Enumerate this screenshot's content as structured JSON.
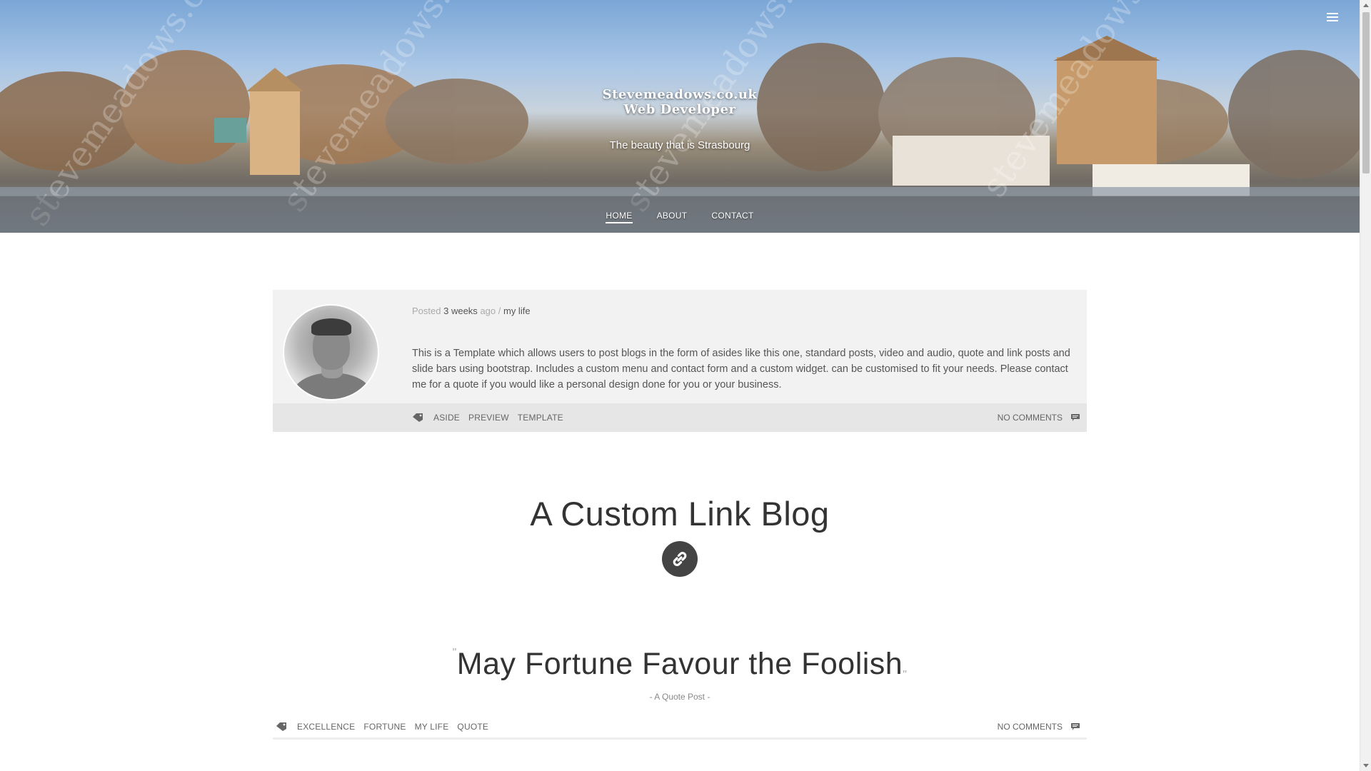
{
  "hero": {
    "title_line1": "Stevemeadows.co.uk",
    "title_line2": "Web Developer",
    "tagline": "The beauty that is Strasbourg",
    "watermark": "stevemeadows.co.uk"
  },
  "nav": {
    "items": [
      {
        "label": "HOME"
      },
      {
        "label": "ABOUT"
      },
      {
        "label": "CONTACT"
      }
    ]
  },
  "aside_post": {
    "meta_prefix": "Posted",
    "meta_time": "3 weeks",
    "meta_suffix": "ago /",
    "meta_category": "my life",
    "body": "This is a Template which allows users to post blogs in the form of asides like this one, standard posts, video and audio, quote and link posts and slide bars using bootstrap. Includes a custom menu and contact form and a custom widget. can be customised to fit your needs. Please contact me for a quote if you would like a personal design done for you or your business.",
    "tags": [
      "ASIDE",
      "PREVIEW",
      "TEMPLATE"
    ],
    "comments": "NO COMMENTS"
  },
  "link_post": {
    "title": "A Custom Link Blog"
  },
  "quote_post": {
    "open_quote": "\"",
    "quote": "May Fortune Favour the Foolish",
    "close_quote": "\"",
    "subtitle": "- A Quote Post -",
    "tags": [
      "EXCELLENCE",
      "FORTUNE",
      "MY LIFE",
      "QUOTE"
    ],
    "comments": "NO COMMENTS"
  },
  "icons": {
    "menu": "hamburger-menu-icon",
    "tag": "tag-icon",
    "comment": "comment-icon",
    "link": "link-icon"
  },
  "colors": {
    "text": "#555555",
    "heading": "#333333",
    "aside_bg": "#f2f2f2",
    "footer_bg": "#e6e6e6",
    "badge_bg": "#444444"
  }
}
